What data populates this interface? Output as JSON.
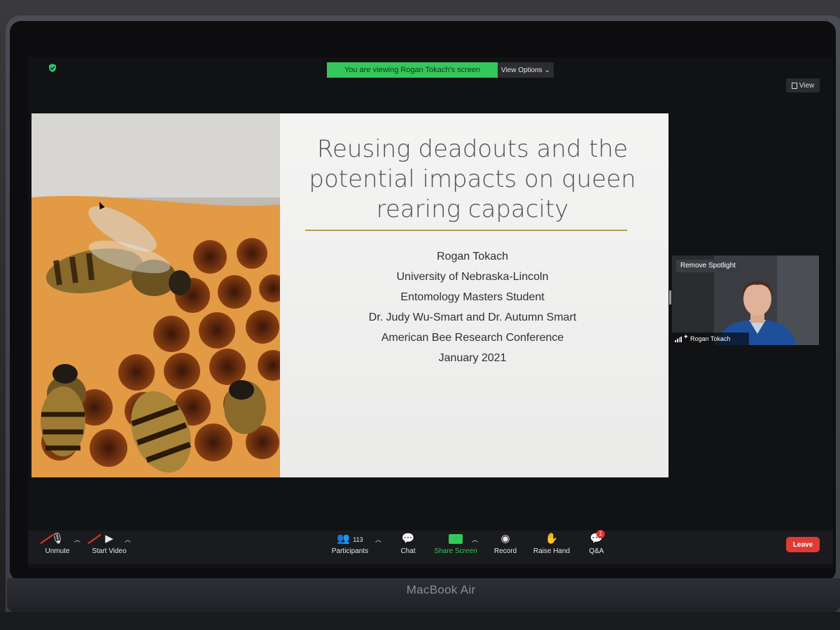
{
  "meeting": {
    "viewing_banner": "You are viewing Rogan Tokach's screen",
    "view_options": "View Options",
    "view_button": "View"
  },
  "slide": {
    "title_lines": [
      "Reusing deadouts and the",
      "potential impacts on queen",
      "rearing capacity"
    ],
    "lines": [
      "Rogan Tokach",
      "University of Nebraska-Lincoln",
      "Entomology Masters Student",
      "Dr. Judy Wu-Smart and Dr. Autumn Smart",
      "American Bee Research Conference",
      "January 2021"
    ]
  },
  "speaker": {
    "spotlight_button": "Remove Spotlight",
    "name": "Rogan Tokach"
  },
  "toolbar": {
    "unmute": "Unmute",
    "start_video": "Start Video",
    "participants_label": "Participants",
    "participants_count": "113",
    "chat": "Chat",
    "share_screen": "Share Screen",
    "record": "Record",
    "raise_hand": "Raise Hand",
    "qa": "Q&A",
    "qa_badge": "1",
    "leave": "Leave"
  },
  "device": {
    "brand": "MacBook Air"
  },
  "colors": {
    "green": "#34c759",
    "leave": "#e03a36",
    "rule": "#b89a58"
  }
}
